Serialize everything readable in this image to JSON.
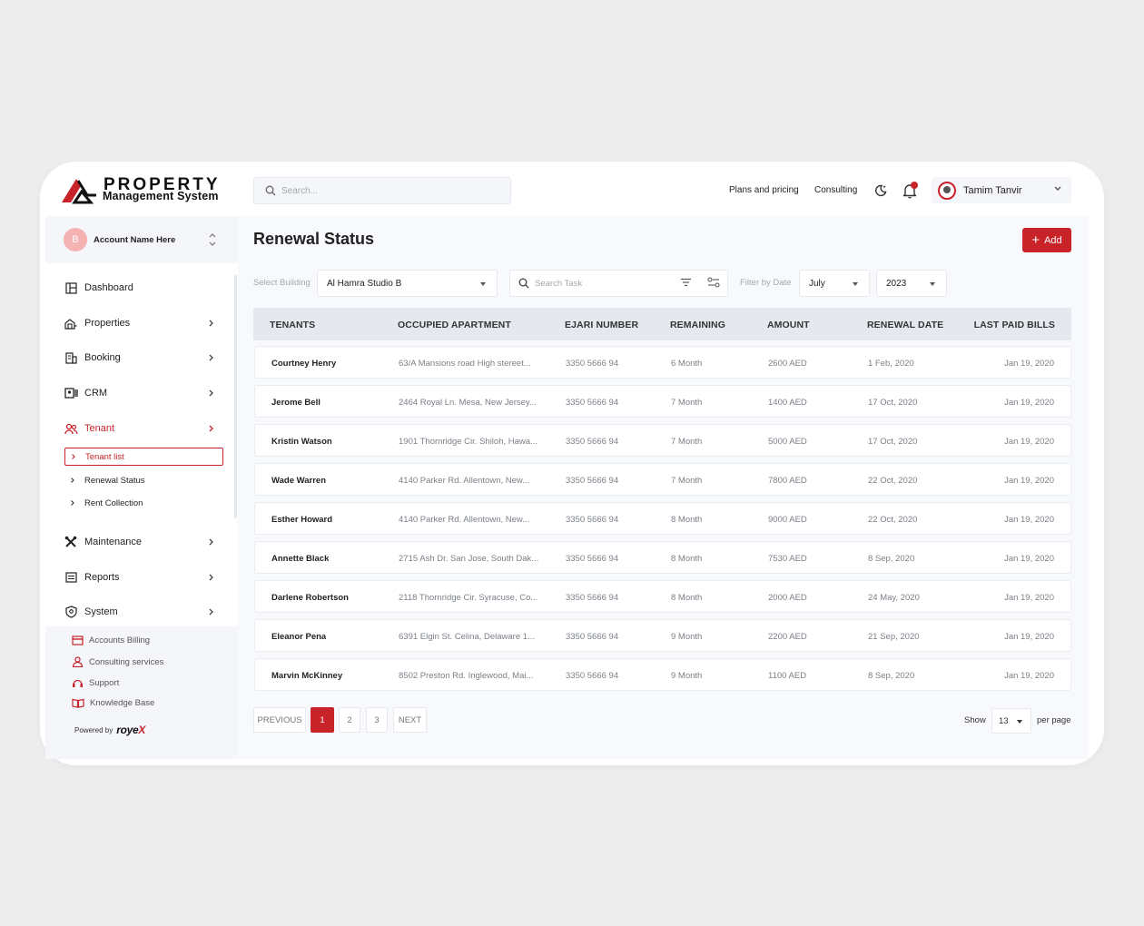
{
  "app": {
    "logo_title": "PROPERTY",
    "logo_subtitle": "Management System"
  },
  "header": {
    "search_placeholder": "Search...",
    "links": [
      "Plans and pricing",
      "Consulting"
    ],
    "user_name": "Tamim Tanvir",
    "notification_color": "#c9232a"
  },
  "account": {
    "initial": "B",
    "name": "Account Name Here"
  },
  "sidebar": {
    "items": [
      {
        "label": "Dashboard",
        "icon": "dashboard-icon"
      },
      {
        "label": "Properties",
        "icon": "properties-icon"
      },
      {
        "label": "Booking",
        "icon": "booking-icon"
      },
      {
        "label": "CRM",
        "icon": "crm-icon"
      },
      {
        "label": "Tenant",
        "icon": "tenant-icon"
      },
      {
        "label": "Maintenance",
        "icon": "maintenance-icon"
      },
      {
        "label": "Reports",
        "icon": "reports-icon"
      },
      {
        "label": "System",
        "icon": "system-icon"
      }
    ],
    "tenant_sub": [
      "Tenant list",
      "Renewal Status",
      "Rent Collection"
    ],
    "bottom": [
      {
        "label": "Accounts Billing",
        "icon": "billing-icon"
      },
      {
        "label": "Consulting services",
        "icon": "consulting-icon"
      },
      {
        "label": "Support",
        "icon": "support-icon"
      },
      {
        "label": "Knowledge Base",
        "icon": "book-icon"
      }
    ],
    "powered_by": "Powered by",
    "brand_main": "roye",
    "brand_accent": "X"
  },
  "page": {
    "title": "Renewal Status",
    "add_label": "Add"
  },
  "filters": {
    "building_label": "Select Building",
    "building_value": "Al Hamra Studio B",
    "task_placeholder": "Search Task",
    "date_label": "Filter by  Date",
    "month": "July",
    "year": "2023"
  },
  "table": {
    "columns": [
      "TENANTS",
      "OCCUPIED APARTMENT",
      "EJARI NUMBER",
      "REMAINING",
      "AMOUNT",
      "RENEWAL DATE",
      "LAST PAID BILLS"
    ],
    "rows": [
      {
        "tenant": "Courtney Henry",
        "apartment": "63/A Mansions road High stereet...",
        "ejari": "3350 5666 94",
        "remaining": "6 Month",
        "amount": "2600 AED",
        "renewal": "1 Feb, 2020",
        "last_paid": "Jan 19, 2020"
      },
      {
        "tenant": "Jerome Bell",
        "apartment": "2464 Royal Ln. Mesa, New Jersey...",
        "ejari": "3350 5666 94",
        "remaining": "7 Month",
        "amount": "1400 AED",
        "renewal": "17 Oct, 2020",
        "last_paid": "Jan 19, 2020"
      },
      {
        "tenant": "Kristin Watson",
        "apartment": "1901 Thornridge Cir. Shiloh, Hawa...",
        "ejari": "3350 5666 94",
        "remaining": "7 Month",
        "amount": "5000 AED",
        "renewal": "17 Oct, 2020",
        "last_paid": "Jan 19, 2020"
      },
      {
        "tenant": "Wade Warren",
        "apartment": "4140 Parker Rd. Allentown, New...",
        "ejari": "3350 5666 94",
        "remaining": "7 Month",
        "amount": "7800 AED",
        "renewal": "22 Oct, 2020",
        "last_paid": "Jan 19, 2020"
      },
      {
        "tenant": "Esther Howard",
        "apartment": "4140 Parker Rd. Allentown, New...",
        "ejari": "3350 5666 94",
        "remaining": "8 Month",
        "amount": "9000 AED",
        "renewal": "22 Oct, 2020",
        "last_paid": "Jan 19, 2020"
      },
      {
        "tenant": "Annette Black",
        "apartment": "2715 Ash Dr. San Jose, South Dak...",
        "ejari": "3350 5666 94",
        "remaining": "8 Month",
        "amount": "7530 AED",
        "renewal": "8 Sep, 2020",
        "last_paid": "Jan 19, 2020"
      },
      {
        "tenant": "Darlene Robertson",
        "apartment": "2118 Thornridge Cir. Syracuse, Co...",
        "ejari": "3350 5666 94",
        "remaining": "8 Month",
        "amount": "2000 AED",
        "renewal": "24 May, 2020",
        "last_paid": "Jan 19, 2020"
      },
      {
        "tenant": "Eleanor Pena",
        "apartment": "6391 Elgin St. Celina, Delaware 1...",
        "ejari": "3350 5666 94",
        "remaining": "9 Month",
        "amount": "2200 AED",
        "renewal": "21 Sep, 2020",
        "last_paid": "Jan 19, 2020"
      },
      {
        "tenant": "Marvin McKinney",
        "apartment": "8502 Preston Rd. Inglewood, Mai...",
        "ejari": "3350 5666 94",
        "remaining": "9 Month",
        "amount": "1100 AED",
        "renewal": "8 Sep, 2020",
        "last_paid": "Jan 19, 2020"
      }
    ]
  },
  "pagination": {
    "previous": "PREVIOUS",
    "pages": [
      "1",
      "2",
      "3"
    ],
    "current": "1",
    "next": "NEXT",
    "show_label": "Show",
    "per_page_value": "13",
    "per_page_label": "per page"
  },
  "colors": {
    "accent": "#c9232a",
    "header_bg": "#e5e9ef",
    "panel_bg": "#f4f6fa"
  }
}
